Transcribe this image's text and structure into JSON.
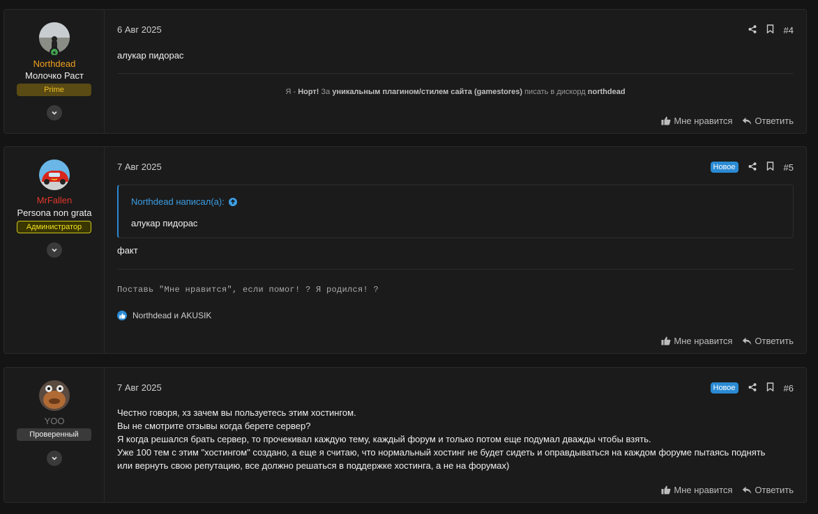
{
  "posts": [
    {
      "author": "Northdead",
      "author_color": "#f0a020",
      "user_title": "Молочко Раст",
      "badge": "Prime",
      "date": "6 Авг 2025",
      "number": "#4",
      "content": "алукар пидорас",
      "signature": {
        "prefix": "Я - ",
        "name": "Норт!",
        "mid": " За ",
        "bold": "уникальным плагином/стилем сайта (gamestores)",
        "suffix": " писать в дискорд ",
        "discord": "northdead"
      },
      "like_label": "Мне нравится",
      "reply_label": "Ответить"
    },
    {
      "author": "MrFallen",
      "author_color": "#e0382a",
      "user_title": "Persona non grata",
      "badge": "Администратор",
      "date": "7 Авг 2025",
      "new_label": "Новое",
      "number": "#5",
      "quote": {
        "author": "Northdead написал(а):",
        "text": "алукар пидорас"
      },
      "content": "факт",
      "signature_text": "Поставь \"Мне нравится\", если помог! ? Я родился! ?",
      "reactions": "Northdead и AKUSIK",
      "like_label": "Мне нравится",
      "reply_label": "Ответить"
    },
    {
      "author": "YOO",
      "author_color": "#7a7a7a",
      "user_title": "",
      "badge": "Проверенный",
      "date": "7 Авг 2025",
      "new_label": "Новое",
      "number": "#6",
      "content_lines": [
        "Честно говоря, хз зачем вы пользуетесь этим хостингом.",
        "Вы не смотрите отзывы когда берете сервер?",
        "Я когда решался брать сервер, то прочекивал каждую тему, каждый форум и только потом еще подумал дважды чтобы взять.",
        "Уже 100 тем с этим \"хостингом\" создано, а еще я считаю, что нормальный хостинг не будет сидеть и оправдываться на каждом форуме пытаясь поднять",
        "или вернуть свою репутацию, все должно решаться в поддержке хостинга, а не на форумах)"
      ],
      "like_label": "Мне нравится",
      "reply_label": "Ответить"
    }
  ],
  "icons": {
    "share": "share-icon",
    "bookmark": "bookmark-icon",
    "like": "thumbs-up-icon",
    "reply": "reply-icon",
    "expand": "chevron-down-icon",
    "quote_jump": "arrow-up-circle-icon",
    "reaction": "like-reaction-icon"
  },
  "colors": {
    "accent": "#2a8ad4",
    "prime_badge_bg": "#5a4a14",
    "prime_badge_text": "#f0c020",
    "admin_badge_bg": "#3a3600",
    "admin_badge_text": "#f0e020",
    "verified_badge_bg": "#3a3a3a"
  }
}
